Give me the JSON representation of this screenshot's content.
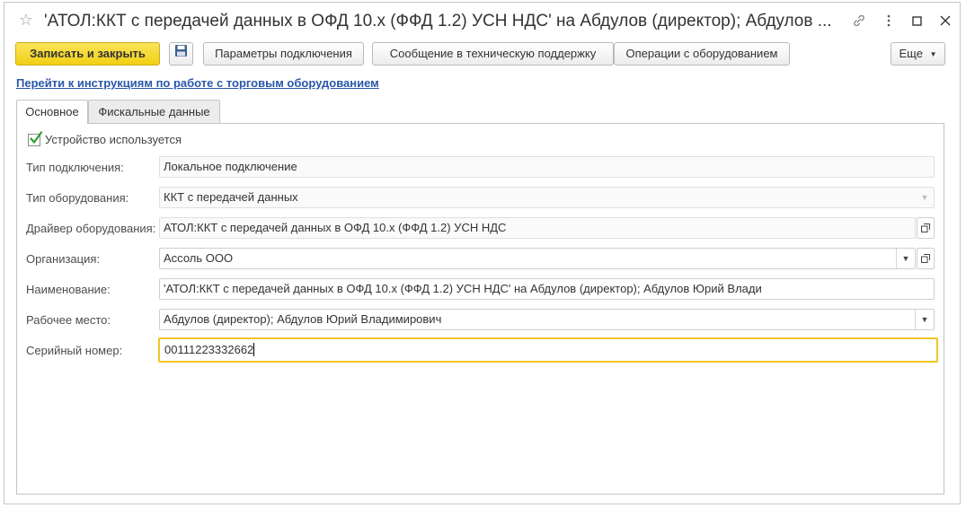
{
  "window": {
    "title": "'АТОЛ:ККТ с передачей данных в ОФД 10.x (ФФД 1.2) УСН НДС' на Абдулов (директор); Абдулов ..."
  },
  "toolbar": {
    "save_close_label": "Записать и закрыть",
    "params_label": "Параметры подключения",
    "support_label": "Сообщение в техническую поддержку",
    "ops_label": "Операции с оборудованием",
    "more_label": "Еще"
  },
  "link": {
    "label": "Перейти к инструкциям по работе с торговым оборудованием"
  },
  "tabs": [
    {
      "label": "Основное",
      "active": true
    },
    {
      "label": "Фискальные данные",
      "active": false
    }
  ],
  "form": {
    "device_used_label": "Устройство используется",
    "device_used": true,
    "connection_type": {
      "label": "Тип подключения:",
      "value": "Локальное подключение"
    },
    "equipment_type": {
      "label": "Тип оборудования:",
      "value": "ККТ с передачей данных"
    },
    "driver": {
      "label": "Драйвер оборудования:",
      "value": "АТОЛ:ККТ с передачей данных в ОФД 10.x (ФФД 1.2) УСН НДС"
    },
    "organization": {
      "label": "Организация:",
      "value": "Ассоль ООО"
    },
    "name": {
      "label": "Наименование:",
      "value": "'АТОЛ:ККТ с передачей данных в ОФД 10.x (ФФД 1.2) УСН НДС' на Абдулов (директор); Абдулов Юрий Влади"
    },
    "workplace": {
      "label": "Рабочее место:",
      "value": "Абдулов (директор); Абдулов Юрий Владимирович"
    },
    "serial": {
      "label": "Серийный номер:",
      "value": "00111223332662"
    }
  },
  "colors": {
    "primary_button": "#f5d322",
    "link": "#2a57a8",
    "focus_border": "#f2c623",
    "check": "#2f9e2f"
  },
  "icons": [
    "star-icon",
    "link-icon",
    "more-icon",
    "maximize-icon",
    "close-icon",
    "floppy-disk-icon",
    "chevron-down-icon",
    "open-window-icon",
    "checkmark-icon"
  ]
}
